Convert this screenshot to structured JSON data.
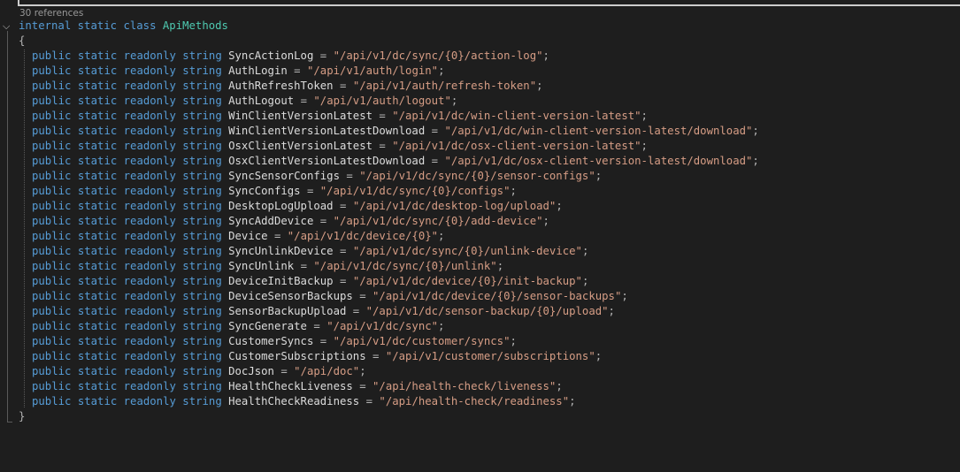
{
  "codelens": "30 references",
  "header": {
    "kw1": "internal",
    "kw2": "static",
    "kw3": "class",
    "class_name": "ApiMethods"
  },
  "open_brace": "{",
  "close_brace": "}",
  "member_prefix": {
    "kw1": "public",
    "kw2": "static",
    "kw3": "readonly",
    "type": "string"
  },
  "members": [
    {
      "name": "SyncActionLog",
      "value": "\"/api/v1/dc/sync/{0}/action-log\""
    },
    {
      "name": "AuthLogin",
      "value": "\"/api/v1/auth/login\""
    },
    {
      "name": "AuthRefreshToken",
      "value": "\"/api/v1/auth/refresh-token\""
    },
    {
      "name": "AuthLogout",
      "value": "\"/api/v1/auth/logout\""
    },
    {
      "name": "WinClientVersionLatest",
      "value": "\"/api/v1/dc/win-client-version-latest\""
    },
    {
      "name": "WinClientVersionLatestDownload",
      "value": "\"/api/v1/dc/win-client-version-latest/download\""
    },
    {
      "name": "OsxClientVersionLatest",
      "value": "\"/api/v1/dc/osx-client-version-latest\""
    },
    {
      "name": "OsxClientVersionLatestDownload",
      "value": "\"/api/v1/dc/osx-client-version-latest/download\""
    },
    {
      "name": "SyncSensorConfigs",
      "value": "\"/api/v1/dc/sync/{0}/sensor-configs\""
    },
    {
      "name": "SyncConfigs",
      "value": "\"/api/v1/dc/sync/{0}/configs\""
    },
    {
      "name": "DesktopLogUpload",
      "value": "\"/api/v1/dc/desktop-log/upload\""
    },
    {
      "name": "SyncAddDevice",
      "value": "\"/api/v1/dc/sync/{0}/add-device\""
    },
    {
      "name": "Device",
      "value": "\"/api/v1/dc/device/{0}\""
    },
    {
      "name": "SyncUnlinkDevice",
      "value": "\"/api/v1/dc/sync/{0}/unlink-device\""
    },
    {
      "name": "SyncUnlink",
      "value": "\"/api/v1/dc/sync/{0}/unlink\""
    },
    {
      "name": "DeviceInitBackup",
      "value": "\"/api/v1/dc/device/{0}/init-backup\""
    },
    {
      "name": "DeviceSensorBackups",
      "value": "\"/api/v1/dc/device/{0}/sensor-backups\""
    },
    {
      "name": "SensorBackupUpload",
      "value": "\"/api/v1/dc/sensor-backup/{0}/upload\""
    },
    {
      "name": "SyncGenerate",
      "value": "\"/api/v1/dc/sync\""
    },
    {
      "name": "CustomerSyncs",
      "value": "\"/api/v1/dc/customer/syncs\""
    },
    {
      "name": "CustomerSubscriptions",
      "value": "\"/api/v1/customer/subscriptions\""
    },
    {
      "name": "DocJson",
      "value": "\"/api/doc\""
    },
    {
      "name": "HealthCheckLiveness",
      "value": "\"/api/health-check/liveness\""
    },
    {
      "name": "HealthCheckReadiness",
      "value": "\"/api/health-check/readiness\""
    }
  ],
  "colors": {
    "background": "#1e1e1e",
    "keyword": "#569cd6",
    "class_name": "#4ec9b0",
    "identifier": "#dcdcdc",
    "string": "#d69d85"
  }
}
